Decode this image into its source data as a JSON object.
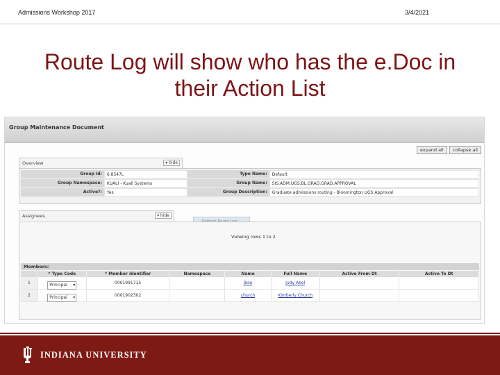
{
  "slide": {
    "header_left": "Admissions Workshop 2017",
    "header_right": "3/4/2021",
    "title_line1": "Route Log will show who has the e.Doc in",
    "title_line2": "their Action List"
  },
  "screenshot": {
    "doc_title": "Group Maintenance Document",
    "buttons": [
      "expand all",
      "collapse all"
    ],
    "overview": {
      "tab_label": "Overview",
      "toggle": "▾ hide",
      "rows": [
        {
          "label": "Group Id:",
          "value": "6.8547L",
          "label2": "Type Name:",
          "value2": "Default"
        },
        {
          "label": "Group Namespace:",
          "value": "KUALI - Kuali Systems",
          "label2": "Group Name:",
          "value2": "SIS.ADM.UGS.BL.GRAD.GRAD.APPROVAL"
        },
        {
          "label": "Active?:",
          "value": "Yes",
          "label2": "Group Description:",
          "value2": "Graduate admissions routing - Bloomington UGS Approval"
        }
      ]
    },
    "assignees": {
      "tab_label": "Assignees",
      "toggle": "▾ hide",
      "route_button": "Refresh Route Log",
      "viewing": "Viewing rows 1 to 2",
      "members_label": "Members:",
      "columns": [
        "",
        "* Type Code",
        "* Member Identifier",
        "Namespace",
        "Name",
        "Full Name",
        "Active From Dt",
        "Active To Dt"
      ],
      "rows": [
        {
          "num": "1",
          "type": "Principal",
          "id": "0001991715",
          "namespace": "",
          "name": "jboe",
          "full_name": "Judy Abel",
          "from": "",
          "to": ""
        },
        {
          "num": "2",
          "type": "Principal",
          "id": "0001902302",
          "namespace": "",
          "name": "church",
          "full_name": "Kimberly Church",
          "from": "",
          "to": ""
        }
      ]
    }
  },
  "footer": {
    "university": "INDIANA UNIVERSITY",
    "brand_color": "#7d1a14"
  }
}
